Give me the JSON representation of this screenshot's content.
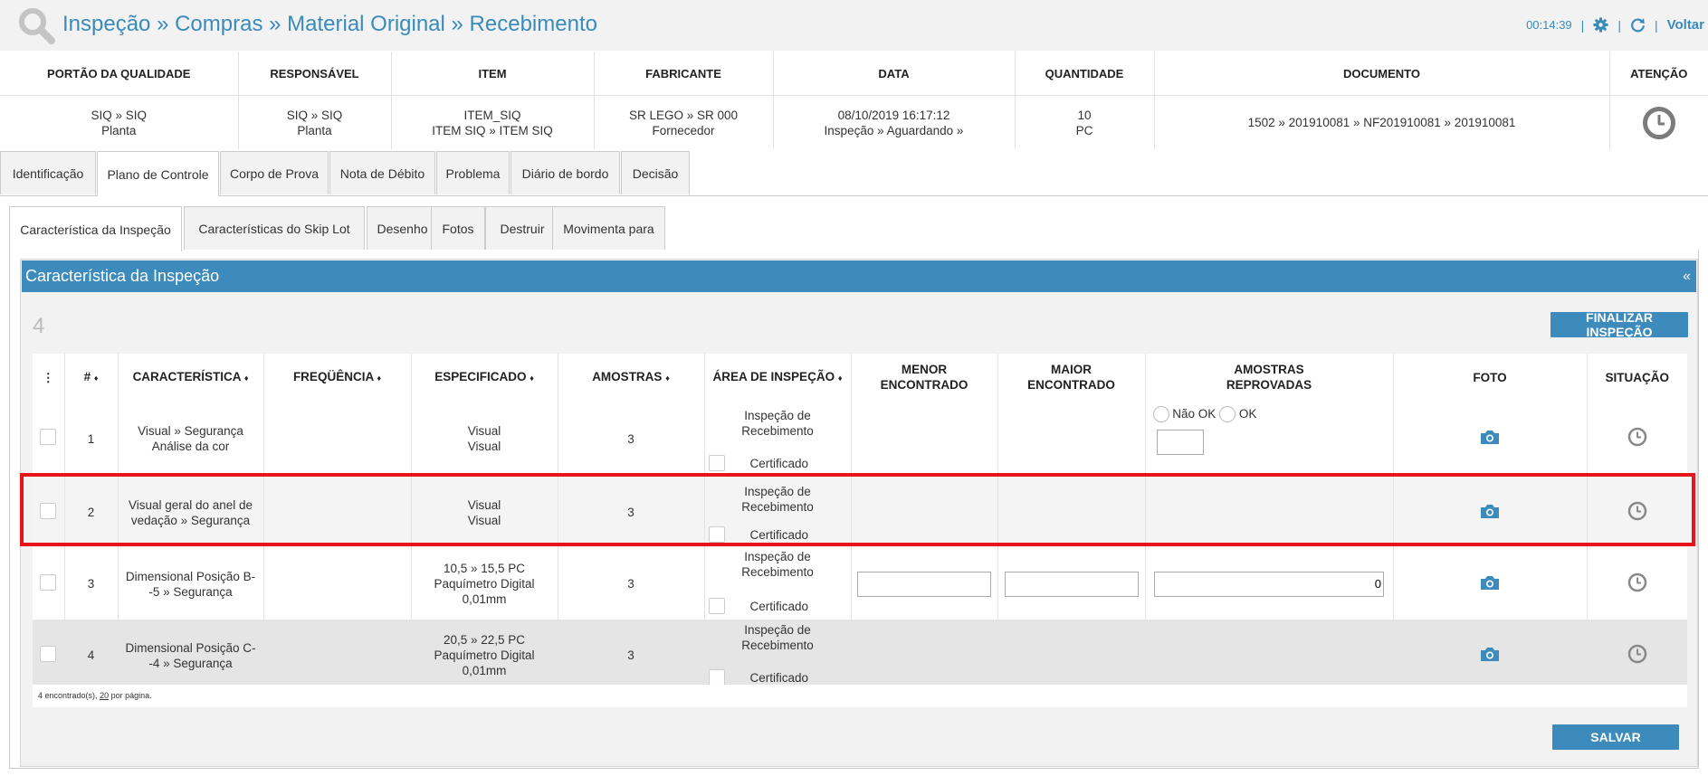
{
  "header": {
    "title": "Inspeção » Compras » Material Original » Recebimento",
    "timer": "00:14:39",
    "separator": "|",
    "back_label": "Voltar"
  },
  "info": {
    "columns": [
      "PORTÃO DA QUALIDADE",
      "RESPONSÁVEL",
      "ITEM",
      "FABRICANTE",
      "DATA",
      "QUANTIDADE",
      "DOCUMENTO",
      "ATENÇÃO"
    ],
    "values": {
      "portao_1": "SIQ » SIQ",
      "portao_2": "Planta",
      "responsavel_1": "SIQ » SIQ",
      "responsavel_2": "Planta",
      "item_1": "ITEM_SIQ",
      "item_2": "ITEM SIQ » ITEM SIQ",
      "fabricante_1": "SR LEGO » SR 000",
      "fabricante_2": "Fornecedor",
      "data_1": "08/10/2019 16:17:12",
      "data_2": "Inspeção » Aguardando »",
      "quantidade_1": "10",
      "quantidade_2": "PC",
      "documento": "1502 » 201910081 » NF201910081 » 201910081"
    }
  },
  "tabs": [
    "Identificação",
    "Plano de Controle",
    "Corpo de Prova",
    "Nota de Débito",
    "Problema",
    "Diário de bordo",
    "Decisão"
  ],
  "subtabs": [
    "Característica da Inspeção",
    "Características do Skip Lot",
    "Desenho",
    "Fotos",
    "Destruir",
    "Movimenta para"
  ],
  "panel": {
    "title": "Característica da Inspeção",
    "collapse": "«",
    "count": "4",
    "finish_button": "FINALIZAR INSPEÇÃO",
    "save_button": "SALVAR",
    "footer_count": "4 encontrado(s),",
    "footer_per_page_num": "20",
    "footer_per_page_txt": "por página."
  },
  "table": {
    "headers": {
      "menu": "⋮",
      "num": "#",
      "caracteristica": "CARACTERÍSTICA",
      "frequencia": "FREQÜÊNCIA",
      "especificado": "ESPECIFICADO",
      "amostras": "AMOSTRAS",
      "area": "ÁREA DE INSPEÇÃO",
      "menor_1": "MENOR",
      "menor_2": "ENCONTRADO",
      "maior_1": "MAIOR",
      "maior_2": "ENCONTRADO",
      "reprov_1": "AMOSTRAS",
      "reprov_2": "REPROVADAS",
      "foto": "FOTO",
      "situacao": "SITUAÇÃO",
      "sort_marker": "♦"
    },
    "rows": [
      {
        "num": "1",
        "car_1": "Visual » Segurança",
        "car_2": "Análise da cor",
        "esp_1": "Visual",
        "esp_2": "Visual",
        "esp_3": "",
        "amostras": "3",
        "area_1": "Inspeção de",
        "area_2": "Recebimento",
        "cert": "Certificado",
        "radio_nok": "Não OK",
        "radio_ok": "OK"
      },
      {
        "num": "2",
        "car_1": "Visual geral do anel de",
        "car_2": "vedação » Segurança",
        "esp_1": "Visual",
        "esp_2": "Visual",
        "esp_3": "",
        "amostras": "3",
        "area_1": "Inspeção de",
        "area_2": "Recebimento",
        "cert": "Certificado"
      },
      {
        "num": "3",
        "car_1": "Dimensional Posição B-",
        "car_2": "-5 » Segurança",
        "esp_1": "10,5 » 15,5 PC",
        "esp_2": "Paquímetro Digital",
        "esp_3": "0,01mm",
        "amostras": "3",
        "area_1": "Inspeção de",
        "area_2": "Recebimento",
        "cert": "Certificado",
        "reprovadas_value": "0"
      },
      {
        "num": "4",
        "car_1": "Dimensional Posição C-",
        "car_2": "-4 » Segurança",
        "esp_1": "20,5 » 22,5 PC",
        "esp_2": "Paquímetro Digital",
        "esp_3": "0,01mm",
        "amostras": "3",
        "area_1": "Inspeção de",
        "area_2": "Recebimento",
        "cert": "Certificado"
      }
    ]
  },
  "colors": {
    "accent": "#3d8bbd",
    "title": "#3a8bbb",
    "highlight": "#e8141b",
    "icon_grey": "#888888"
  }
}
